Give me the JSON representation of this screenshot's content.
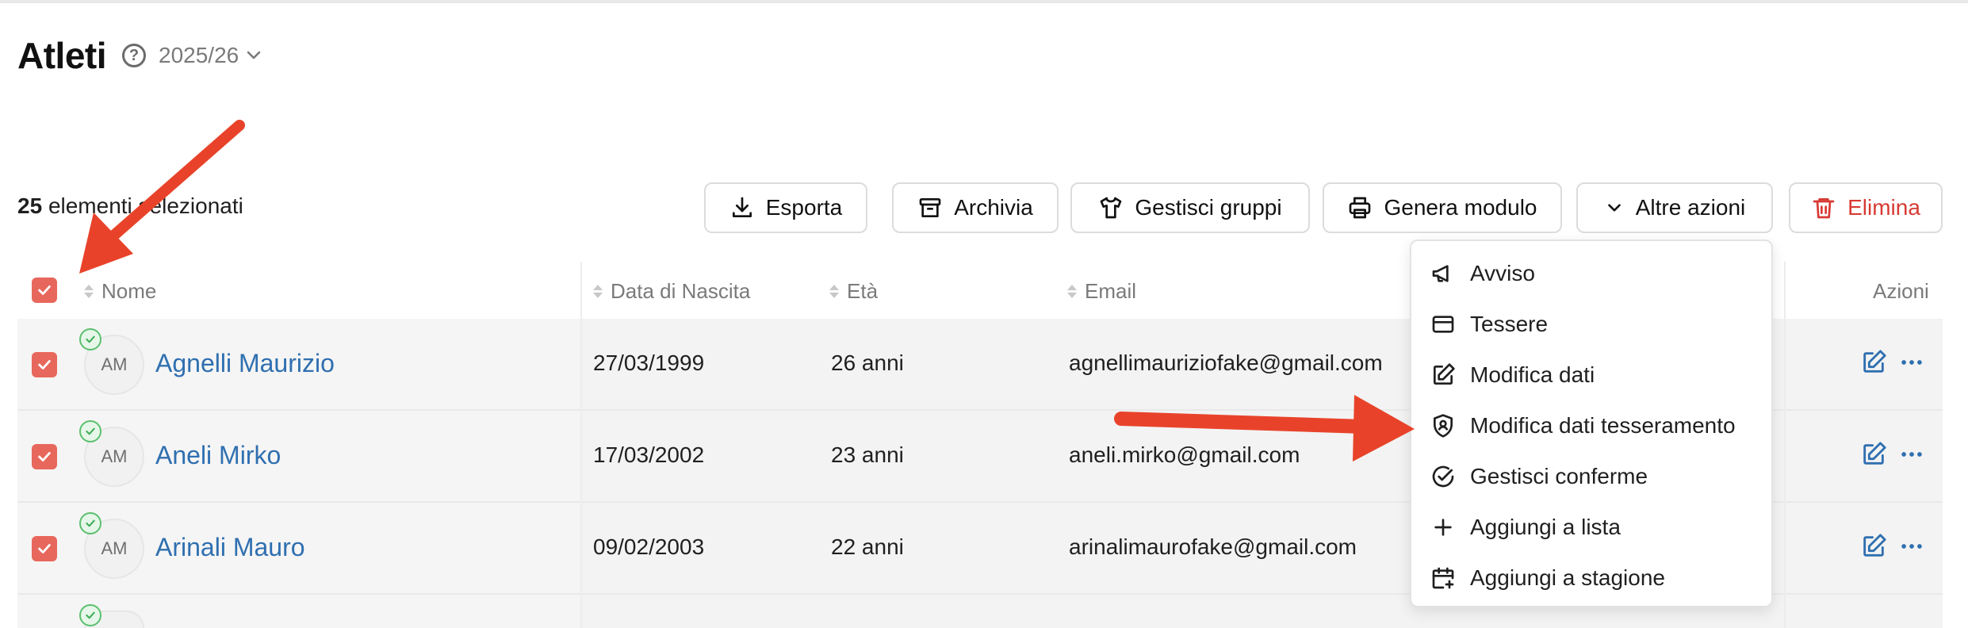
{
  "page": {
    "title": "Atleti",
    "season": "2025/26"
  },
  "selection": {
    "count": "25",
    "label": "elementi selezionati"
  },
  "toolbar": {
    "export": "Esporta",
    "archive": "Archivia",
    "groups": "Gestisci gruppi",
    "form": "Genera modulo",
    "more": "Altre azioni",
    "delete": "Elimina"
  },
  "table": {
    "headers": {
      "name": "Nome",
      "birth": "Data di Nascita",
      "age": "Età",
      "email": "Email",
      "actions": "Azioni"
    },
    "rows": [
      {
        "initials": "AM",
        "name": "Agnelli Maurizio",
        "birth": "27/03/1999",
        "age": "26 anni",
        "email": "agnellimauriziofake@gmail.com"
      },
      {
        "initials": "AM",
        "name": "Aneli Mirko",
        "birth": "17/03/2002",
        "age": "23 anni",
        "email": "aneli.mirko@gmail.com"
      },
      {
        "initials": "AM",
        "name": "Arinali Mauro",
        "birth": "09/02/2003",
        "age": "22 anni",
        "email": "arinalimaurofake@gmail.com"
      }
    ]
  },
  "menu": {
    "items": [
      {
        "label": "Avviso",
        "icon": "megaphone-icon"
      },
      {
        "label": "Tessere",
        "icon": "card-icon"
      },
      {
        "label": "Modifica dati",
        "icon": "edit-icon"
      },
      {
        "label": "Modifica dati tesseramento",
        "icon": "shield-user-icon"
      },
      {
        "label": "Gestisci conferme",
        "icon": "check-circle-icon"
      },
      {
        "label": "Aggiungi a lista",
        "icon": "plus-icon"
      },
      {
        "label": "Aggiungi a stagione",
        "icon": "calendar-plus-icon"
      }
    ]
  },
  "colors": {
    "accent": "#e8675c",
    "link": "#2f6fb0",
    "danger": "#d73a33",
    "annotation": "#e8432a"
  }
}
